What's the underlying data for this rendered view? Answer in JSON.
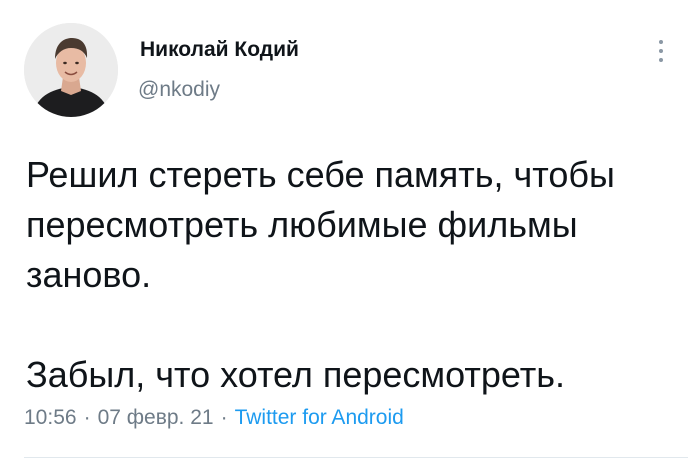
{
  "tweet": {
    "author": {
      "display_name": "Николай Кодий",
      "handle": "@nkodiy"
    },
    "text_paragraphs": [
      "Решил стереть себе память, чтобы\nпересмотреть любимые фильмы\nзаново.",
      "Забыл, что хотел пересмотреть."
    ],
    "time": "10:56",
    "date": "07 февр. 21",
    "separator": "·",
    "source": "Twitter for Android"
  },
  "icons": {
    "more": "more-vertical-icon",
    "avatar": "profile-photo"
  },
  "colors": {
    "text": "#0f1419",
    "secondary": "#6e7b87",
    "link": "#1d9bf0",
    "divider": "#e1e8ed"
  }
}
